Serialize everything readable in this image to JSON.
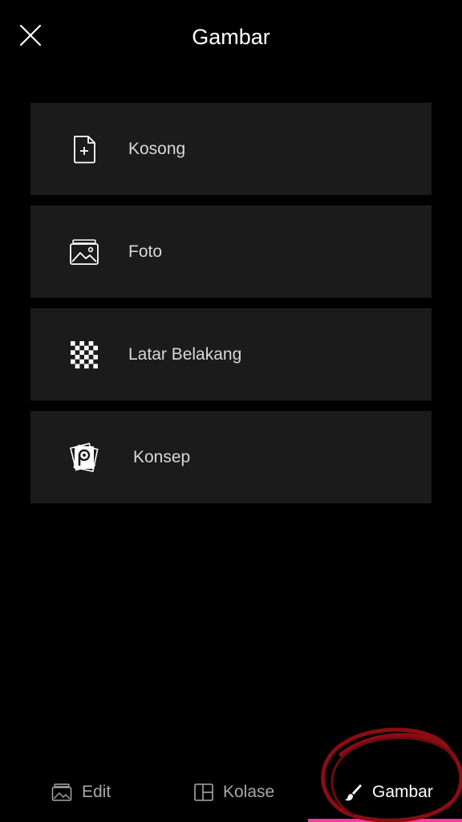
{
  "header": {
    "title": "Gambar",
    "close_icon": "close-icon"
  },
  "menu": {
    "items": [
      {
        "label": "Kosong",
        "icon": "blank-file-plus-icon"
      },
      {
        "label": "Foto",
        "icon": "photo-gallery-icon"
      },
      {
        "label": "Latar Belakang",
        "icon": "checkerboard-background-icon"
      },
      {
        "label": "Konsep",
        "icon": "picsart-template-icon"
      }
    ]
  },
  "bottom_nav": {
    "items": [
      {
        "label": "Edit",
        "icon": "image-edit-icon",
        "active": false
      },
      {
        "label": "Kolase",
        "icon": "collage-grid-icon",
        "active": false
      },
      {
        "label": "Gambar",
        "icon": "brush-icon",
        "active": true
      }
    ]
  },
  "colors": {
    "background": "#000000",
    "card": "#1b1b1b",
    "accent": "#ff3a9e",
    "annotation": "#8a0d12"
  }
}
